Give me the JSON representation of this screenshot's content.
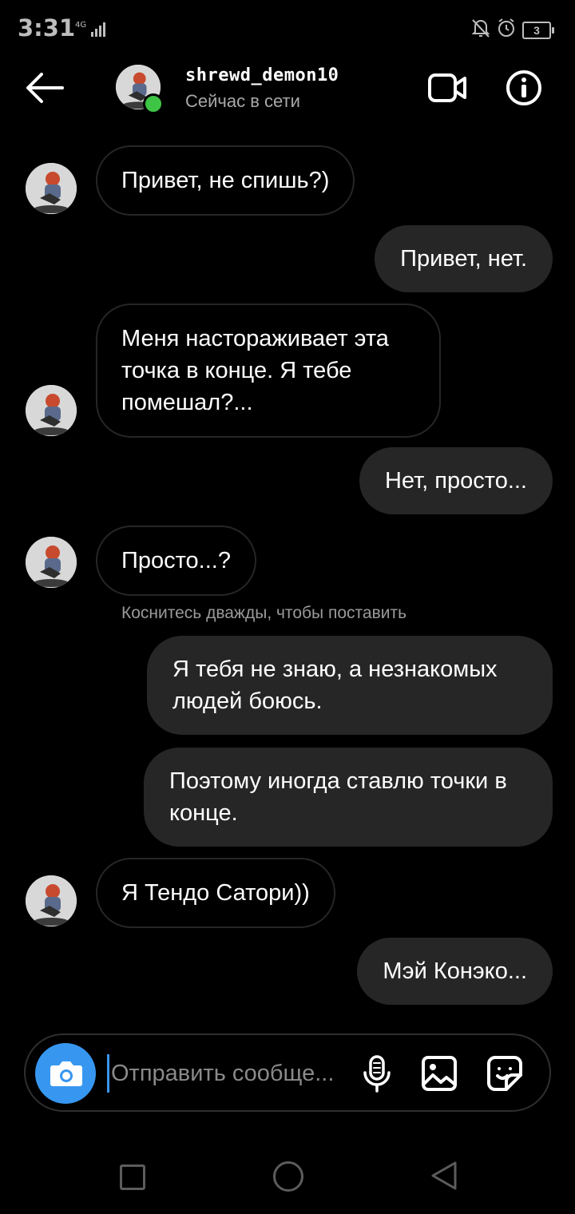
{
  "status_bar": {
    "time": "3:31",
    "network": "4G",
    "battery": "3"
  },
  "header": {
    "username": "shrewd_demon10",
    "status": "Сейчас в сети"
  },
  "messages": [
    {
      "from": "them",
      "text": "Привет, не спишь?)"
    },
    {
      "from": "me",
      "text": "Привет, нет."
    },
    {
      "from": "them",
      "text": "Меня настораживает эта точка в конце. Я тебе помешал?..."
    },
    {
      "from": "me",
      "text": "Нет, просто..."
    },
    {
      "from": "them",
      "text": "Просто...?"
    },
    {
      "from": "me",
      "text": "Я тебя не знаю, а незнакомых людей боюсь."
    },
    {
      "from": "me",
      "text": "Поэтому иногда ставлю точки в конце."
    },
    {
      "from": "them",
      "text": "Я Тендо Сатори))"
    },
    {
      "from": "me",
      "text": "Мэй Конэко..."
    }
  ],
  "hint": "Коснитесь дважды, чтобы поставить",
  "composer": {
    "placeholder": "Отправить сообще..."
  },
  "colors": {
    "background": "#000000",
    "outgoing_bubble": "#262626",
    "incoming_border": "#262626",
    "accent": "#3797f0",
    "online": "#3ec546"
  }
}
